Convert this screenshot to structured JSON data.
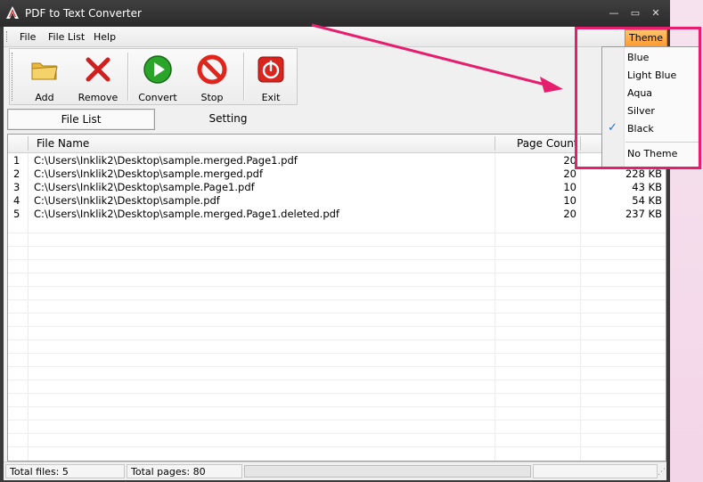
{
  "window": {
    "title": "PDF to Text Converter"
  },
  "menu": {
    "file": "File",
    "file_list": "File List",
    "help": "Help",
    "theme": "Theme"
  },
  "toolbar": {
    "add": "Add",
    "remove": "Remove",
    "convert": "Convert",
    "stop": "Stop",
    "exit": "Exit"
  },
  "tabs": {
    "file_list": "File List",
    "setting": "Setting"
  },
  "table": {
    "headers": {
      "file_name": "File Name",
      "page_count": "Page Count"
    },
    "rows": [
      {
        "index": "1",
        "file": "C:\\Users\\Inklik2\\Desktop\\sample.merged.Page1.pdf",
        "pages": "20",
        "size": ""
      },
      {
        "index": "2",
        "file": "C:\\Users\\Inklik2\\Desktop\\sample.merged.pdf",
        "pages": "20",
        "size": "228 KB"
      },
      {
        "index": "3",
        "file": "C:\\Users\\Inklik2\\Desktop\\sample.Page1.pdf",
        "pages": "10",
        "size": "43 KB"
      },
      {
        "index": "4",
        "file": "C:\\Users\\Inklik2\\Desktop\\sample.pdf",
        "pages": "10",
        "size": "54 KB"
      },
      {
        "index": "5",
        "file": "C:\\Users\\Inklik2\\Desktop\\sample.merged.Page1.deleted.pdf",
        "pages": "20",
        "size": "237 KB"
      }
    ]
  },
  "status": {
    "total_files": "Total files: 5",
    "total_pages": "Total pages: 80"
  },
  "theme_menu": {
    "items": [
      "Blue",
      "Light Blue",
      "Aqua",
      "Silver",
      "Black"
    ],
    "no_theme": "No Theme",
    "selected": "Black"
  },
  "colors": {
    "accent": "#ff9a32",
    "annotation": "#e61e6e"
  }
}
